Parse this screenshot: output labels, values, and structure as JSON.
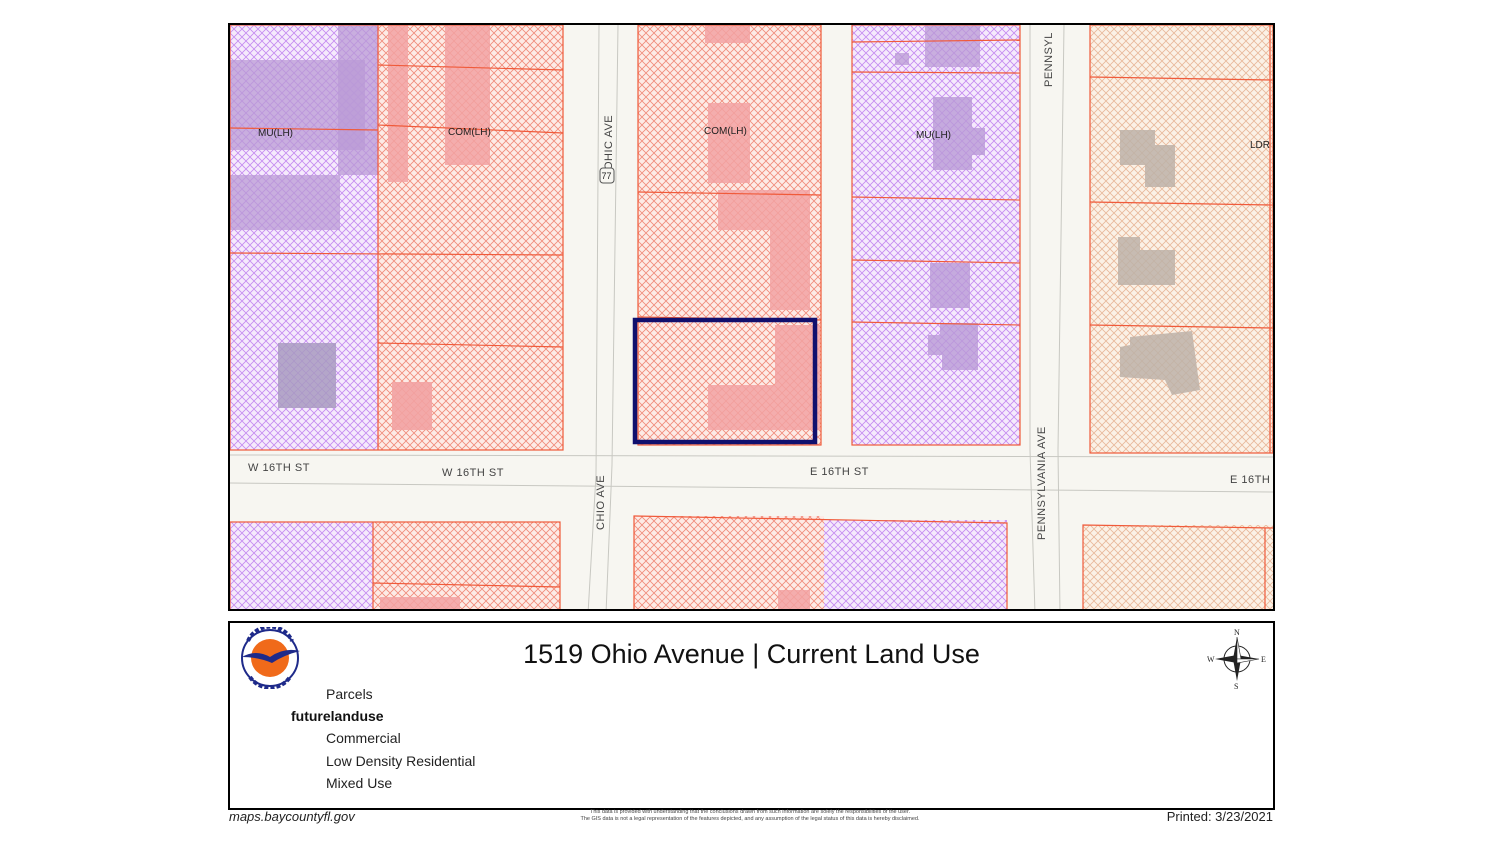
{
  "map": {
    "street_labels": [
      "W 16TH ST",
      "W 16TH ST",
      "E 16TH ST",
      "E 16TH",
      "OHIC AVE",
      "CHIO AVE",
      "PENNSYLVANIA AVE",
      "PENNSYL"
    ],
    "route_shield": "77",
    "zone_labels": [
      "MU(LH)",
      "COM(LH)",
      "COM(LH)",
      "MU(LH)",
      "LDR"
    ],
    "colors": {
      "commercial_hatch": "#f08a7a",
      "commercial_outline": "#f05a3a",
      "mixed_use_hatch": "#c48af0",
      "low_density_hatch": "#e8b89a",
      "building_commercial": "#f2a2a2",
      "building_mixed": "#b99ad6",
      "building_ldr": "#bdb2a8",
      "street": "#f7f6f1",
      "subject_parcel": "#10106e"
    }
  },
  "legend": {
    "title": "1519 Ohio Avenue | Current Land Use",
    "logo_icon": "bay-county-florida-seal-icon",
    "compass_icon": "north-arrow-compass-icon",
    "items": [
      "Parcels",
      "futurelanduse",
      "Commercial",
      "Low Density Residential",
      "Mixed Use"
    ]
  },
  "footer": {
    "url": "maps.baycountyfl.gov",
    "disclaimer_line1": "This data is provided with understanding that the conclusions drawn from such information are solely the responsibilities of the user.",
    "disclaimer_line2": "The GIS data is not a legal representation of the features depicted, and any assumption of the legal status of this data is hereby disclaimed.",
    "printed": "Printed: 3/23/2021"
  }
}
